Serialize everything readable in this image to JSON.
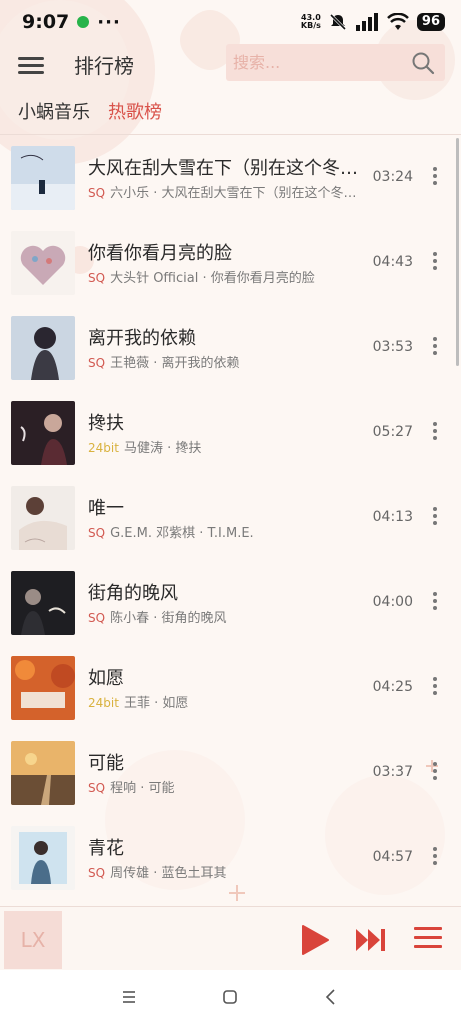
{
  "status_bar": {
    "time": "9:07",
    "more": "···",
    "net_speed_value": "43.0",
    "net_speed_unit": "KB/s",
    "battery": "96"
  },
  "header": {
    "title": "排行榜",
    "search_placeholder": "搜索..."
  },
  "tabs": [
    {
      "label": "小蜗音乐",
      "active": false
    },
    {
      "label": "热歌榜",
      "active": true
    }
  ],
  "songs": [
    {
      "name": "大风在刮大雪在下（别在这个冬天…",
      "quality": "SQ",
      "subtitle": "六小乐 · 大风在刮大雪在下（别在这个冬把…",
      "duration": "03:24"
    },
    {
      "name": "你看你看月亮的脸",
      "quality": "SQ",
      "subtitle": "大头针 Official · 你看你看月亮的脸",
      "duration": "04:43"
    },
    {
      "name": "离开我的依赖",
      "quality": "SQ",
      "subtitle": "王艳薇 · 离开我的依赖",
      "duration": "03:53"
    },
    {
      "name": "搀扶",
      "quality": "24bit",
      "subtitle": "马健涛 · 搀扶",
      "duration": "05:27"
    },
    {
      "name": "唯一",
      "quality": "SQ",
      "subtitle": "G.E.M. 邓紫棋 · T.I.M.E.",
      "duration": "04:13"
    },
    {
      "name": "街角的晚风",
      "quality": "SQ",
      "subtitle": "陈小春 · 街角的晚风",
      "duration": "04:00"
    },
    {
      "name": "如愿",
      "quality": "24bit",
      "subtitle": "王菲 · 如愿",
      "duration": "04:25"
    },
    {
      "name": "可能",
      "quality": "SQ",
      "subtitle": "程响 · 可能",
      "duration": "03:37"
    },
    {
      "name": "青花",
      "quality": "SQ",
      "subtitle": "周传雄 · 蓝色土耳其",
      "duration": "04:57"
    }
  ],
  "player": {
    "art_text": "LX"
  },
  "colors": {
    "accent": "#d9443b",
    "background": "#fdf7f3",
    "search_bg": "#f7dfd9"
  }
}
